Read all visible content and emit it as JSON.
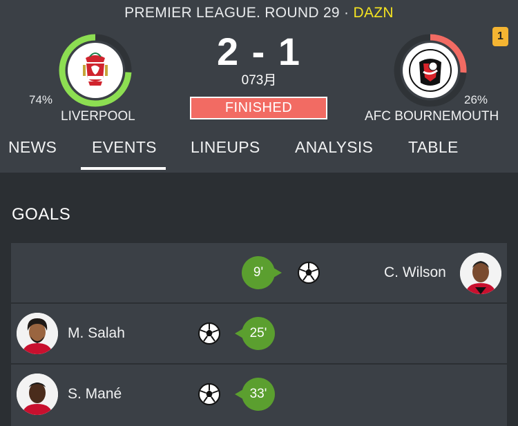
{
  "header": {
    "league": "PREMIER LEAGUE. ROUND 29",
    "separator": "·",
    "broadcaster": "DAZN",
    "notification_count": "1"
  },
  "match": {
    "home": {
      "name": "LIVERPOOL",
      "percent": "74%",
      "percent_value": 0.74
    },
    "away": {
      "name": "AFC BOURNEMOUTH",
      "percent": "26%",
      "percent_value": 0.26
    },
    "score": "2 - 1",
    "date": "073月",
    "status": "FINISHED"
  },
  "tabs": [
    {
      "label": "NEWS"
    },
    {
      "label": "EVENTS",
      "active": true
    },
    {
      "label": "LINEUPS"
    },
    {
      "label": "ANALYSIS"
    },
    {
      "label": "TABLE"
    }
  ],
  "goals": {
    "title": "GOALS",
    "events": [
      {
        "minute": "9'",
        "player": "C. Wilson",
        "side": "away"
      },
      {
        "minute": "25'",
        "player": "M. Salah",
        "side": "home"
      },
      {
        "minute": "33'",
        "player": "S. Mané",
        "side": "home"
      }
    ]
  },
  "colors": {
    "home_ring": "#8dde52",
    "away_ring": "#f26b63",
    "status_bg": "#f26b63",
    "minute_bg": "#5b9f2f",
    "broadcaster": "#f4e321"
  },
  "icons": [
    "liverpool-crest-icon",
    "bournemouth-crest-icon",
    "soccer-ball-icon"
  ]
}
